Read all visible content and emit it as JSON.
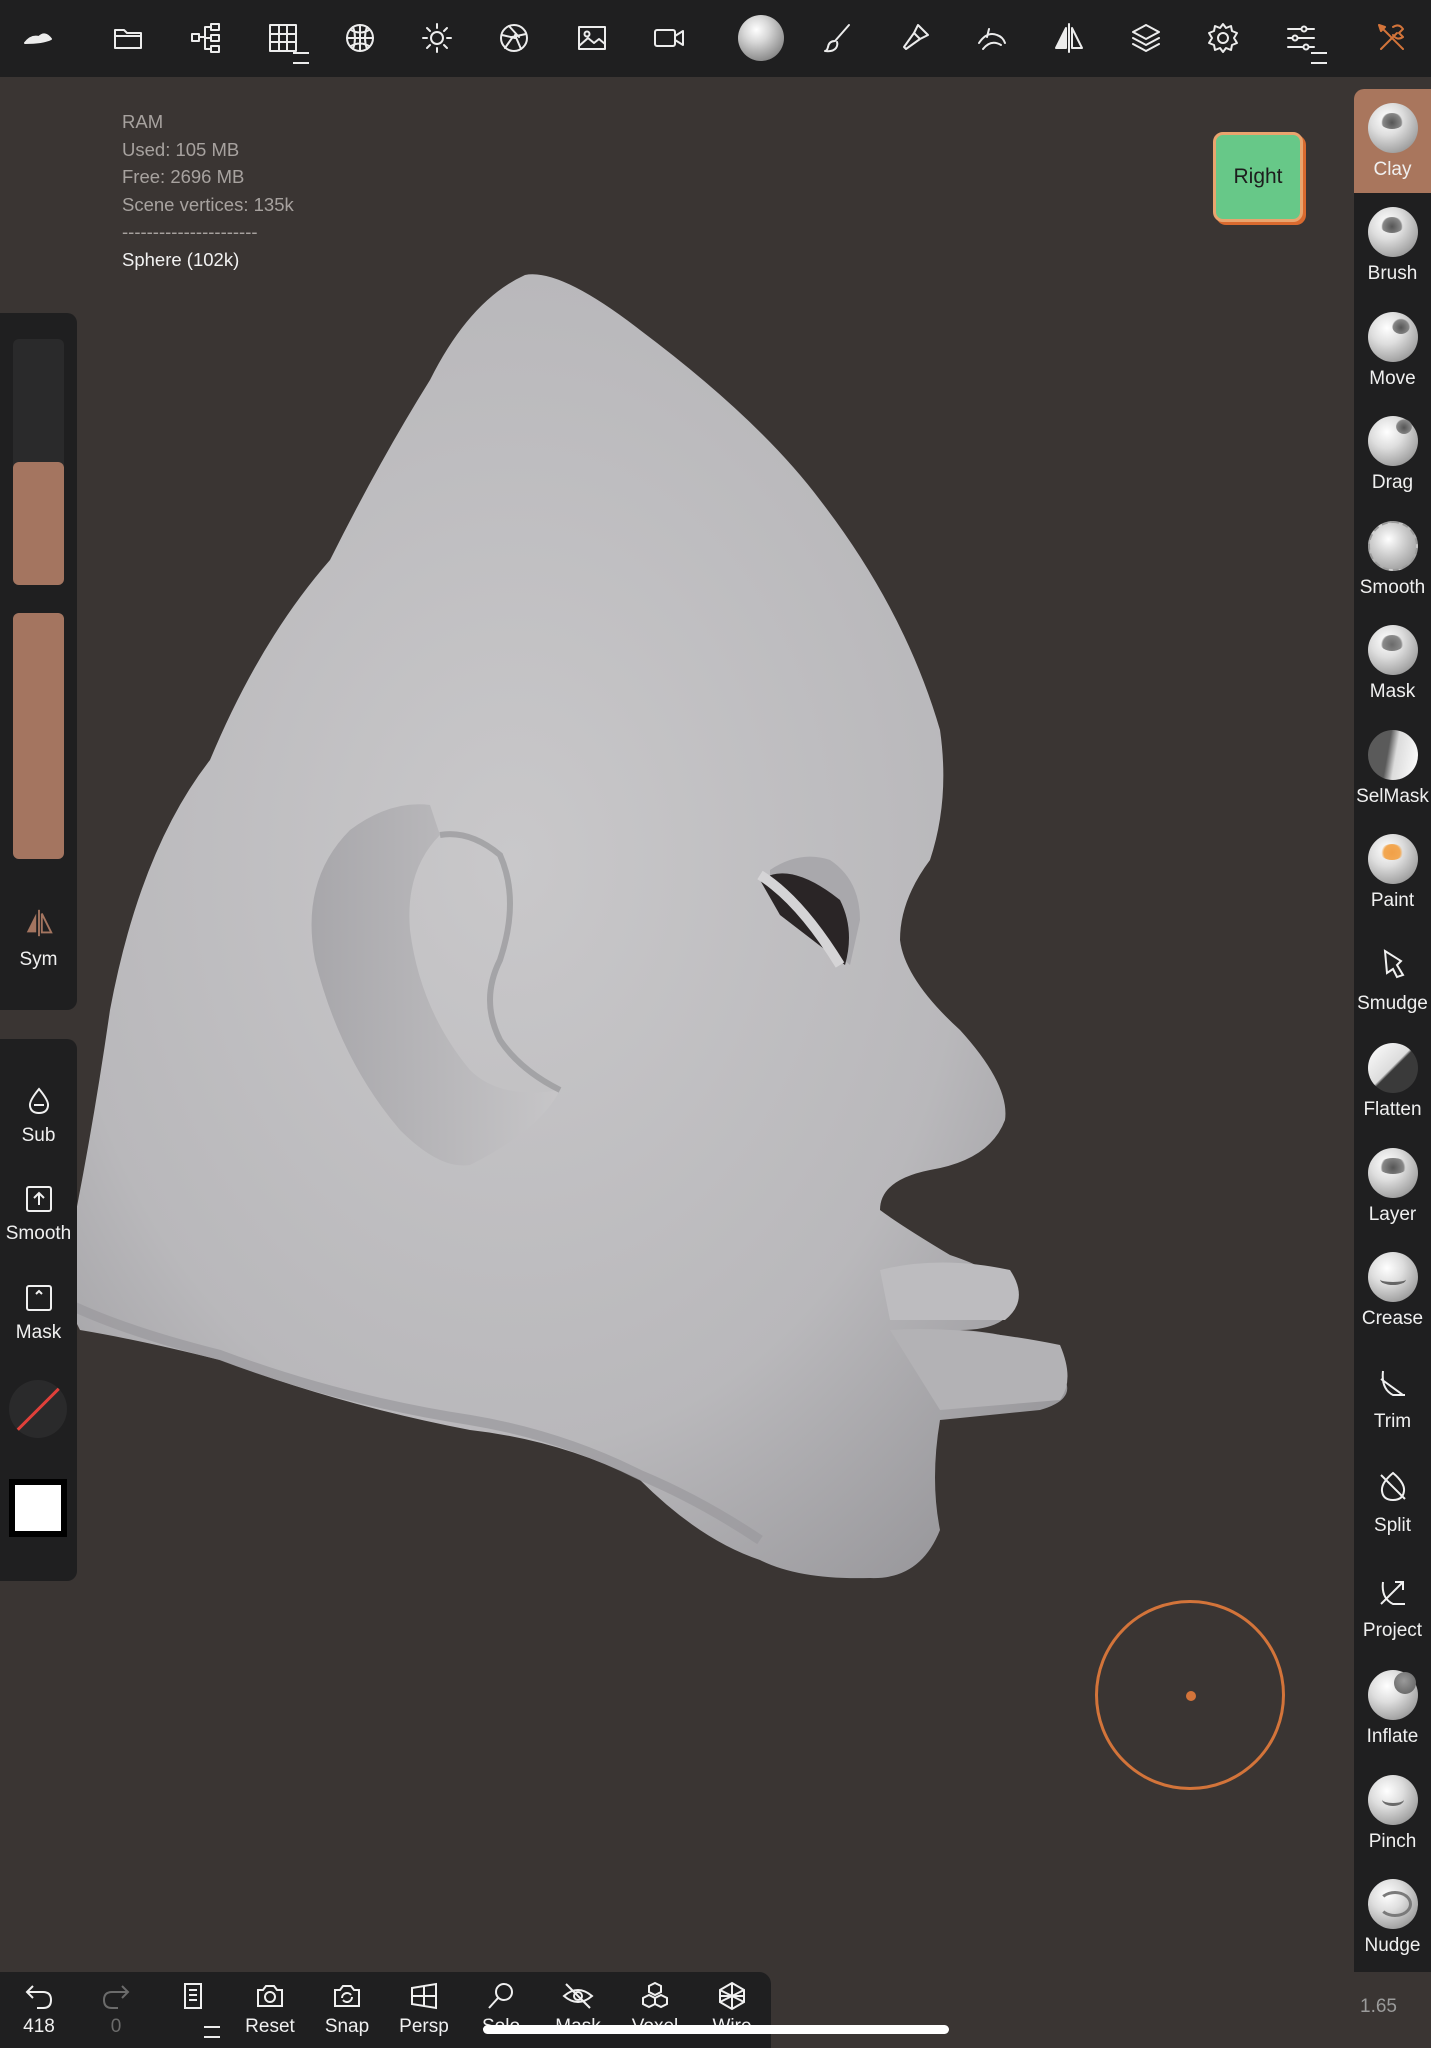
{
  "stats": {
    "ram_label": "RAM",
    "used": "Used: 105 MB",
    "free": "Free: 2696 MB",
    "vertices": "Scene vertices: 135k",
    "separator": "----------------------",
    "object": "Sphere (102k)"
  },
  "view_cube": {
    "label": "Right"
  },
  "left_panel": {
    "sym_label": "Sym",
    "sub_label": "Sub",
    "smooth_label": "Smooth",
    "mask_label": "Mask",
    "radius_level": 0.5,
    "intensity_level": 1.0
  },
  "tools": [
    {
      "label": "Clay",
      "active": true
    },
    {
      "label": "Brush"
    },
    {
      "label": "Move"
    },
    {
      "label": "Drag"
    },
    {
      "label": "Smooth"
    },
    {
      "label": "Mask"
    },
    {
      "label": "SelMask"
    },
    {
      "label": "Paint"
    },
    {
      "label": "Smudge"
    },
    {
      "label": "Flatten"
    },
    {
      "label": "Layer"
    },
    {
      "label": "Crease"
    },
    {
      "label": "Trim"
    },
    {
      "label": "Split"
    },
    {
      "label": "Project"
    },
    {
      "label": "Inflate"
    },
    {
      "label": "Pinch"
    },
    {
      "label": "Nudge"
    }
  ],
  "bottombar": {
    "undo_count": "418",
    "redo_count": "0",
    "reset": "Reset",
    "snap": "Snap",
    "persp": "Persp",
    "solo": "Solo",
    "mask": "Mask",
    "voxel": "Voxel",
    "wire": "Wire"
  },
  "zoom": "1.65",
  "colors": {
    "accent": "#a9765d",
    "background": "#3a3533",
    "panel": "#1f1f20",
    "view_cube": "#67c888",
    "cursor": "#d3743a"
  }
}
